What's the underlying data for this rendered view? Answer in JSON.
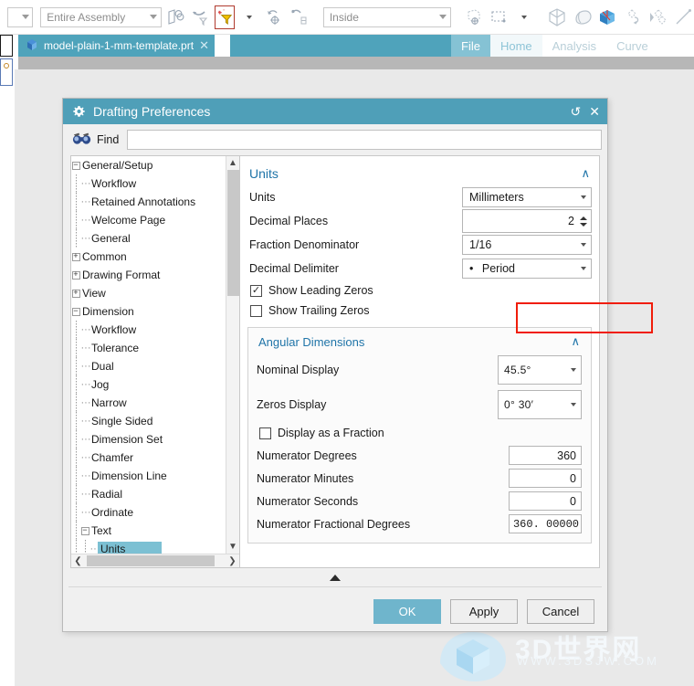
{
  "toolbar": {
    "assembly_filter": "Entire Assembly",
    "inside_filter": "Inside",
    "icons": [
      "assembly-icon",
      "filter-funnel-icon",
      "selection-filter-icon",
      "dropdown-arrow-icon",
      "undo-icon",
      "snap-point-icon",
      "datum-filter-icon",
      "work-part-icon",
      "rectangle-select-icon",
      "view-box-icon",
      "shaded-view-icon",
      "colored-box-icon",
      "move-object-icon",
      "pattern-icon",
      "line-icon"
    ]
  },
  "doc_tab": {
    "name": "model-plain-1-mm-template.prt",
    "close": "✕"
  },
  "ribbon": {
    "tabs": [
      "File",
      "Home",
      "Analysis",
      "Curve"
    ]
  },
  "dialog": {
    "title": "Drafting Preferences",
    "title_icons": {
      "reset": "↺",
      "close": "✕"
    },
    "find": {
      "label": "Find",
      "value": "",
      "placeholder": ""
    },
    "tree": [
      {
        "label": "General/Setup",
        "level": 0,
        "expander": "−",
        "selected": false
      },
      {
        "label": "Workflow",
        "level": 1,
        "expander": "",
        "selected": false
      },
      {
        "label": "Retained Annotations",
        "level": 1,
        "expander": "",
        "selected": false
      },
      {
        "label": "Welcome Page",
        "level": 1,
        "expander": "",
        "selected": false
      },
      {
        "label": "General",
        "level": 1,
        "expander": "",
        "selected": false
      },
      {
        "label": "Common",
        "level": 0,
        "expander": "+",
        "selected": false
      },
      {
        "label": "Drawing Format",
        "level": 0,
        "expander": "+",
        "selected": false
      },
      {
        "label": "View",
        "level": 0,
        "expander": "+",
        "selected": false
      },
      {
        "label": "Dimension",
        "level": 0,
        "expander": "−",
        "selected": false
      },
      {
        "label": "Workflow",
        "level": 1,
        "expander": "",
        "selected": false
      },
      {
        "label": "Tolerance",
        "level": 1,
        "expander": "",
        "selected": false
      },
      {
        "label": "Dual",
        "level": 1,
        "expander": "",
        "selected": false
      },
      {
        "label": "Jog",
        "level": 1,
        "expander": "",
        "selected": false
      },
      {
        "label": "Narrow",
        "level": 1,
        "expander": "",
        "selected": false
      },
      {
        "label": "Single Sided",
        "level": 1,
        "expander": "",
        "selected": false
      },
      {
        "label": "Dimension Set",
        "level": 1,
        "expander": "",
        "selected": false
      },
      {
        "label": "Chamfer",
        "level": 1,
        "expander": "",
        "selected": false
      },
      {
        "label": "Dimension Line",
        "level": 1,
        "expander": "",
        "selected": false
      },
      {
        "label": "Radial",
        "level": 1,
        "expander": "",
        "selected": false
      },
      {
        "label": "Ordinate",
        "level": 1,
        "expander": "",
        "selected": false
      },
      {
        "label": "Text",
        "level": 1,
        "expander": "−",
        "selected": false
      },
      {
        "label": "Units",
        "level": 2,
        "expander": "",
        "selected": true
      }
    ],
    "units_section": {
      "header": "Units",
      "collapse_chevron": "∧",
      "units": {
        "label": "Units",
        "value": "Millimeters"
      },
      "decimal_places": {
        "label": "Decimal Places",
        "value": "2"
      },
      "fraction_denominator": {
        "label": "Fraction Denominator",
        "value": "1/16"
      },
      "decimal_delimiter": {
        "label": "Decimal Delimiter",
        "value": "Period",
        "bullet": "•"
      },
      "show_leading_zeros": {
        "label": "Show Leading Zeros",
        "checked": true,
        "mark": "✓"
      },
      "show_trailing_zeros": {
        "label": "Show Trailing Zeros",
        "checked": false,
        "mark": ""
      }
    },
    "angular_section": {
      "header": "Angular Dimensions",
      "collapse_chevron": "∧",
      "nominal_display": {
        "label": "Nominal Display",
        "value": "45.5°"
      },
      "zeros_display": {
        "label": "Zeros Display",
        "value": "0° 30′"
      },
      "display_as_fraction": {
        "label": "Display as a Fraction",
        "checked": false,
        "mark": ""
      },
      "numerator_degrees": {
        "label": "Numerator Degrees",
        "value": "360"
      },
      "numerator_minutes": {
        "label": "Numerator Minutes",
        "value": "0"
      },
      "numerator_seconds": {
        "label": "Numerator Seconds",
        "value": "0"
      },
      "numerator_fractional_degrees": {
        "label": "Numerator Fractional Degrees",
        "value": "360. 00000"
      }
    },
    "buttons": {
      "ok": "OK",
      "apply": "Apply",
      "cancel": "Cancel"
    }
  },
  "watermark": {
    "text": "3D世界网",
    "url": "WWW.3DSJW.COM"
  },
  "colors": {
    "accent": "#4f9fb8",
    "selection": "#7cc0d3",
    "section_header": "#1f74a8",
    "highlight_box": "#f01d0a",
    "tab": "#4fa3bb"
  }
}
